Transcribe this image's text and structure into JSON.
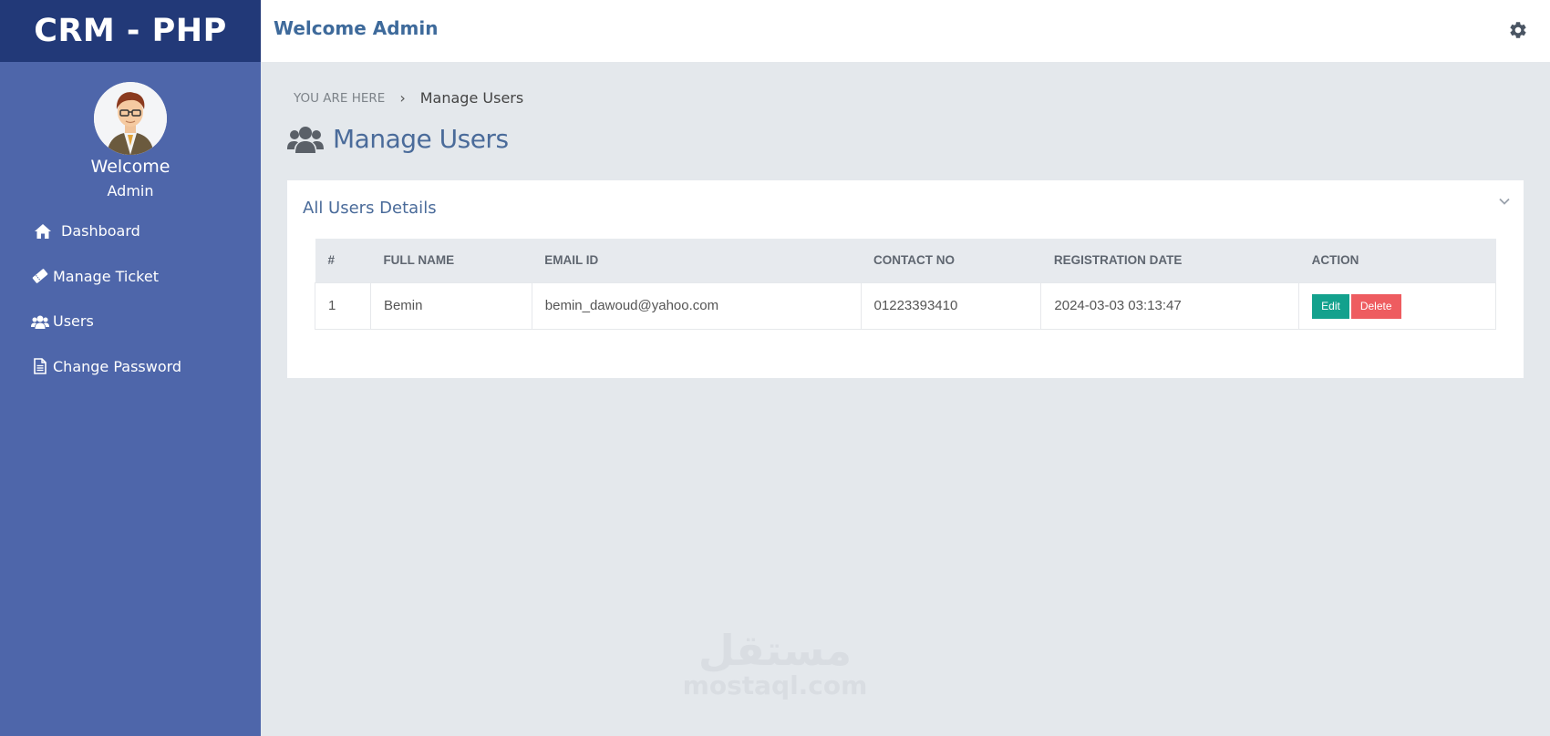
{
  "sidebar": {
    "brand": "CRM - PHP",
    "welcome": "Welcome",
    "user_name": "Admin",
    "items": [
      {
        "label": "Dashboard",
        "icon": "home-icon"
      },
      {
        "label": "Manage Ticket",
        "icon": "ticket-icon"
      },
      {
        "label": "Users",
        "icon": "users-icon"
      },
      {
        "label": "Change Password",
        "icon": "document-icon"
      }
    ]
  },
  "header": {
    "title": "Welcome Admin",
    "settings_icon": "gear-icon"
  },
  "breadcrumb": {
    "prefix": "YOU ARE HERE",
    "separator": "›",
    "current": "Manage Users"
  },
  "page": {
    "title": "Manage Users"
  },
  "panel": {
    "title": "All Users Details",
    "table": {
      "columns": [
        "#",
        "FULL NAME",
        "EMAIL ID",
        "CONTACT NO",
        "REGISTRATION DATE",
        "ACTION"
      ],
      "rows": [
        {
          "num": "1",
          "full_name": "Bemin",
          "email": "bemin_dawoud@yahoo.com",
          "contact": "01223393410",
          "registration_date": "2024-03-03 03:13:47",
          "edit_label": "Edit",
          "delete_label": "Delete"
        }
      ]
    }
  },
  "watermark": {
    "arabic": "مستقل",
    "latin": "mostaql.com"
  },
  "colors": {
    "sidebar": "#4e66aa",
    "brand_bar": "#223978",
    "accent_text": "#4a6b9a",
    "edit_button": "#13a18d",
    "delete_button": "#ee5c60",
    "background": "#e4e8ec"
  }
}
